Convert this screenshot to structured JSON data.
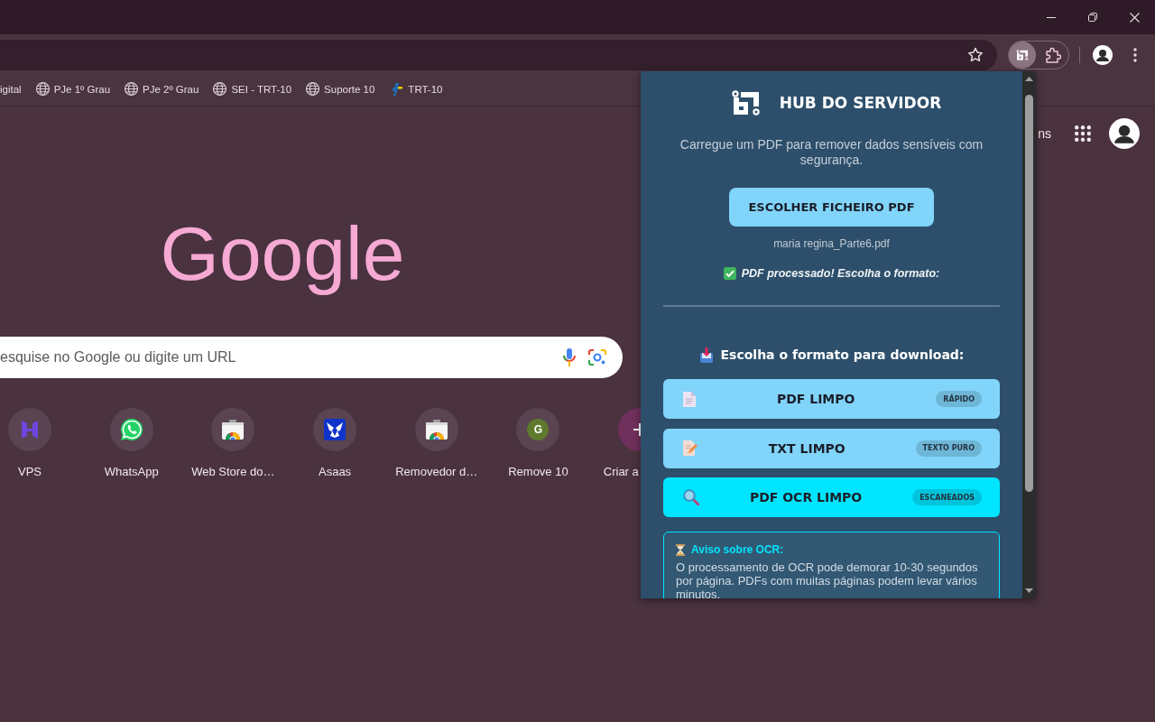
{
  "bookmarks": [
    {
      "label": "igital",
      "kind": "plain"
    },
    {
      "label": "PJe 1º Grau",
      "kind": "globe"
    },
    {
      "label": "PJe 2º Grau",
      "kind": "globe"
    },
    {
      "label": "SEI - TRT-10",
      "kind": "globe"
    },
    {
      "label": "Suporte 10",
      "kind": "globe"
    },
    {
      "label": "TRT-10",
      "kind": "logo"
    }
  ],
  "page": {
    "header_links": [
      "ns"
    ],
    "logo": "Google",
    "search": {
      "placeholder": "esquise no Google ou digite um URL"
    },
    "shortcuts": [
      {
        "label": "VPS",
        "kind": "h-logo"
      },
      {
        "label": "WhatsApp",
        "kind": "chat"
      },
      {
        "label": "Web Store do…",
        "kind": "store"
      },
      {
        "label": "Asaas",
        "kind": "wings"
      },
      {
        "label": "Removedor d…",
        "kind": "store"
      },
      {
        "label": "Remove 10",
        "kind": "letter",
        "initial": "G"
      },
      {
        "label": "Criar a",
        "kind": "add"
      }
    ]
  },
  "popup": {
    "title": "HUB DO SERVIDOR",
    "subtitle": "Carregue um PDF para remover dados sensíveis com segurança.",
    "file_button": "ESCOLHER FICHEIRO PDF",
    "file_name": "maria regina_Parte6.pdf",
    "status": "PDF processado! Escolha o formato:",
    "download_heading": "Escolha o formato para download:",
    "options": [
      {
        "label": "PDF LIMPO",
        "badge": "RÁPIDO",
        "kind": "document",
        "color": "#81d4fa"
      },
      {
        "label": "TXT LIMPO",
        "badge": "TEXTO PURO",
        "kind": "edit",
        "color": "#81d4fa"
      },
      {
        "label": "PDF OCR LIMPO",
        "badge": "ESCANEADOS",
        "kind": "search",
        "color": "#00e5ff"
      }
    ],
    "notice": {
      "title": "Aviso sobre OCR:",
      "body": "O processamento de OCR pode demorar 10-30 segundos por página. PDFs com muitas páginas podem levar vários minutos."
    }
  }
}
